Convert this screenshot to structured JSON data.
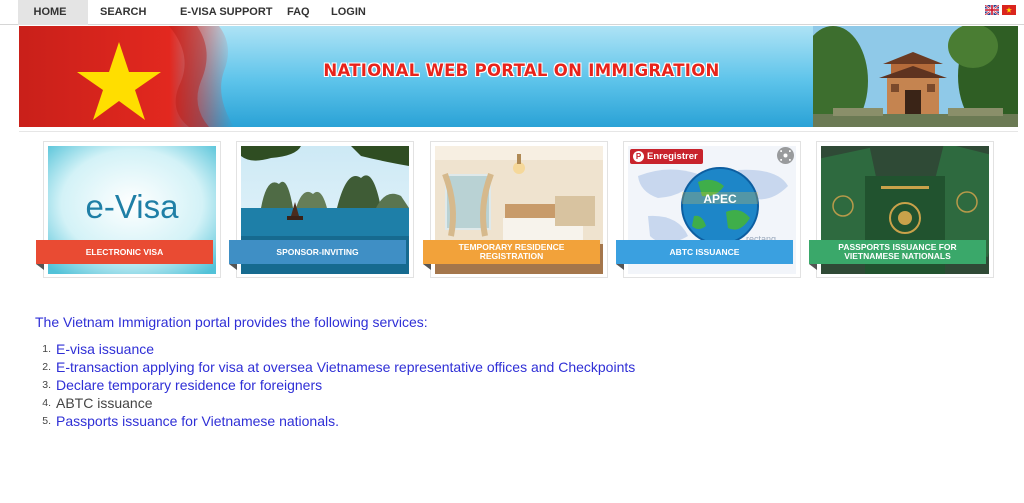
{
  "nav": {
    "items": [
      {
        "label": "HOME"
      },
      {
        "label": "SEARCH"
      },
      {
        "label": "E-VISA SUPPORT"
      },
      {
        "label": "FAQ"
      },
      {
        "label": "LOGIN"
      }
    ]
  },
  "banner": {
    "title": "NATIONAL WEB PORTAL ON IMMIGRATION"
  },
  "cards": [
    {
      "label": "ELECTRONIC VISA",
      "logo": "e-Visa",
      "color": "#e94b33"
    },
    {
      "label": "SPONSOR-INVITING",
      "color": "#3f8fc5"
    },
    {
      "label": "TEMPORARY RESIDENCE REGISTRATION",
      "color": "#f2a23a"
    },
    {
      "label": "ABTC ISSUANCE",
      "logo": "APEC",
      "pin_label": "Enregistrer",
      "watermark": "rectang",
      "color": "#3aa0e0"
    },
    {
      "label": "PASSPORTS ISSUANCE FOR VIETNAMESE NATIONALS",
      "color": "#3aa86a"
    }
  ],
  "intro": "The Vietnam Immigration portal provides the following services:",
  "services": [
    {
      "num": "1.",
      "text": "E-visa issuance"
    },
    {
      "num": "2.",
      "text": "E-transaction applying for visa at oversea Vietnamese representative offices and Checkpoints"
    },
    {
      "num": "3.",
      "text": "Declare temporary residence for foreigners"
    },
    {
      "num": "4.",
      "text": "ABTC issuance"
    },
    {
      "num": "5.",
      "text": "Passports issuance for Vietnamese nationals."
    }
  ],
  "colors": {
    "link": "#2f2fd6",
    "banner_title": "#e8231b",
    "flag_red": "#da251d",
    "star_yellow": "#ffde00"
  }
}
